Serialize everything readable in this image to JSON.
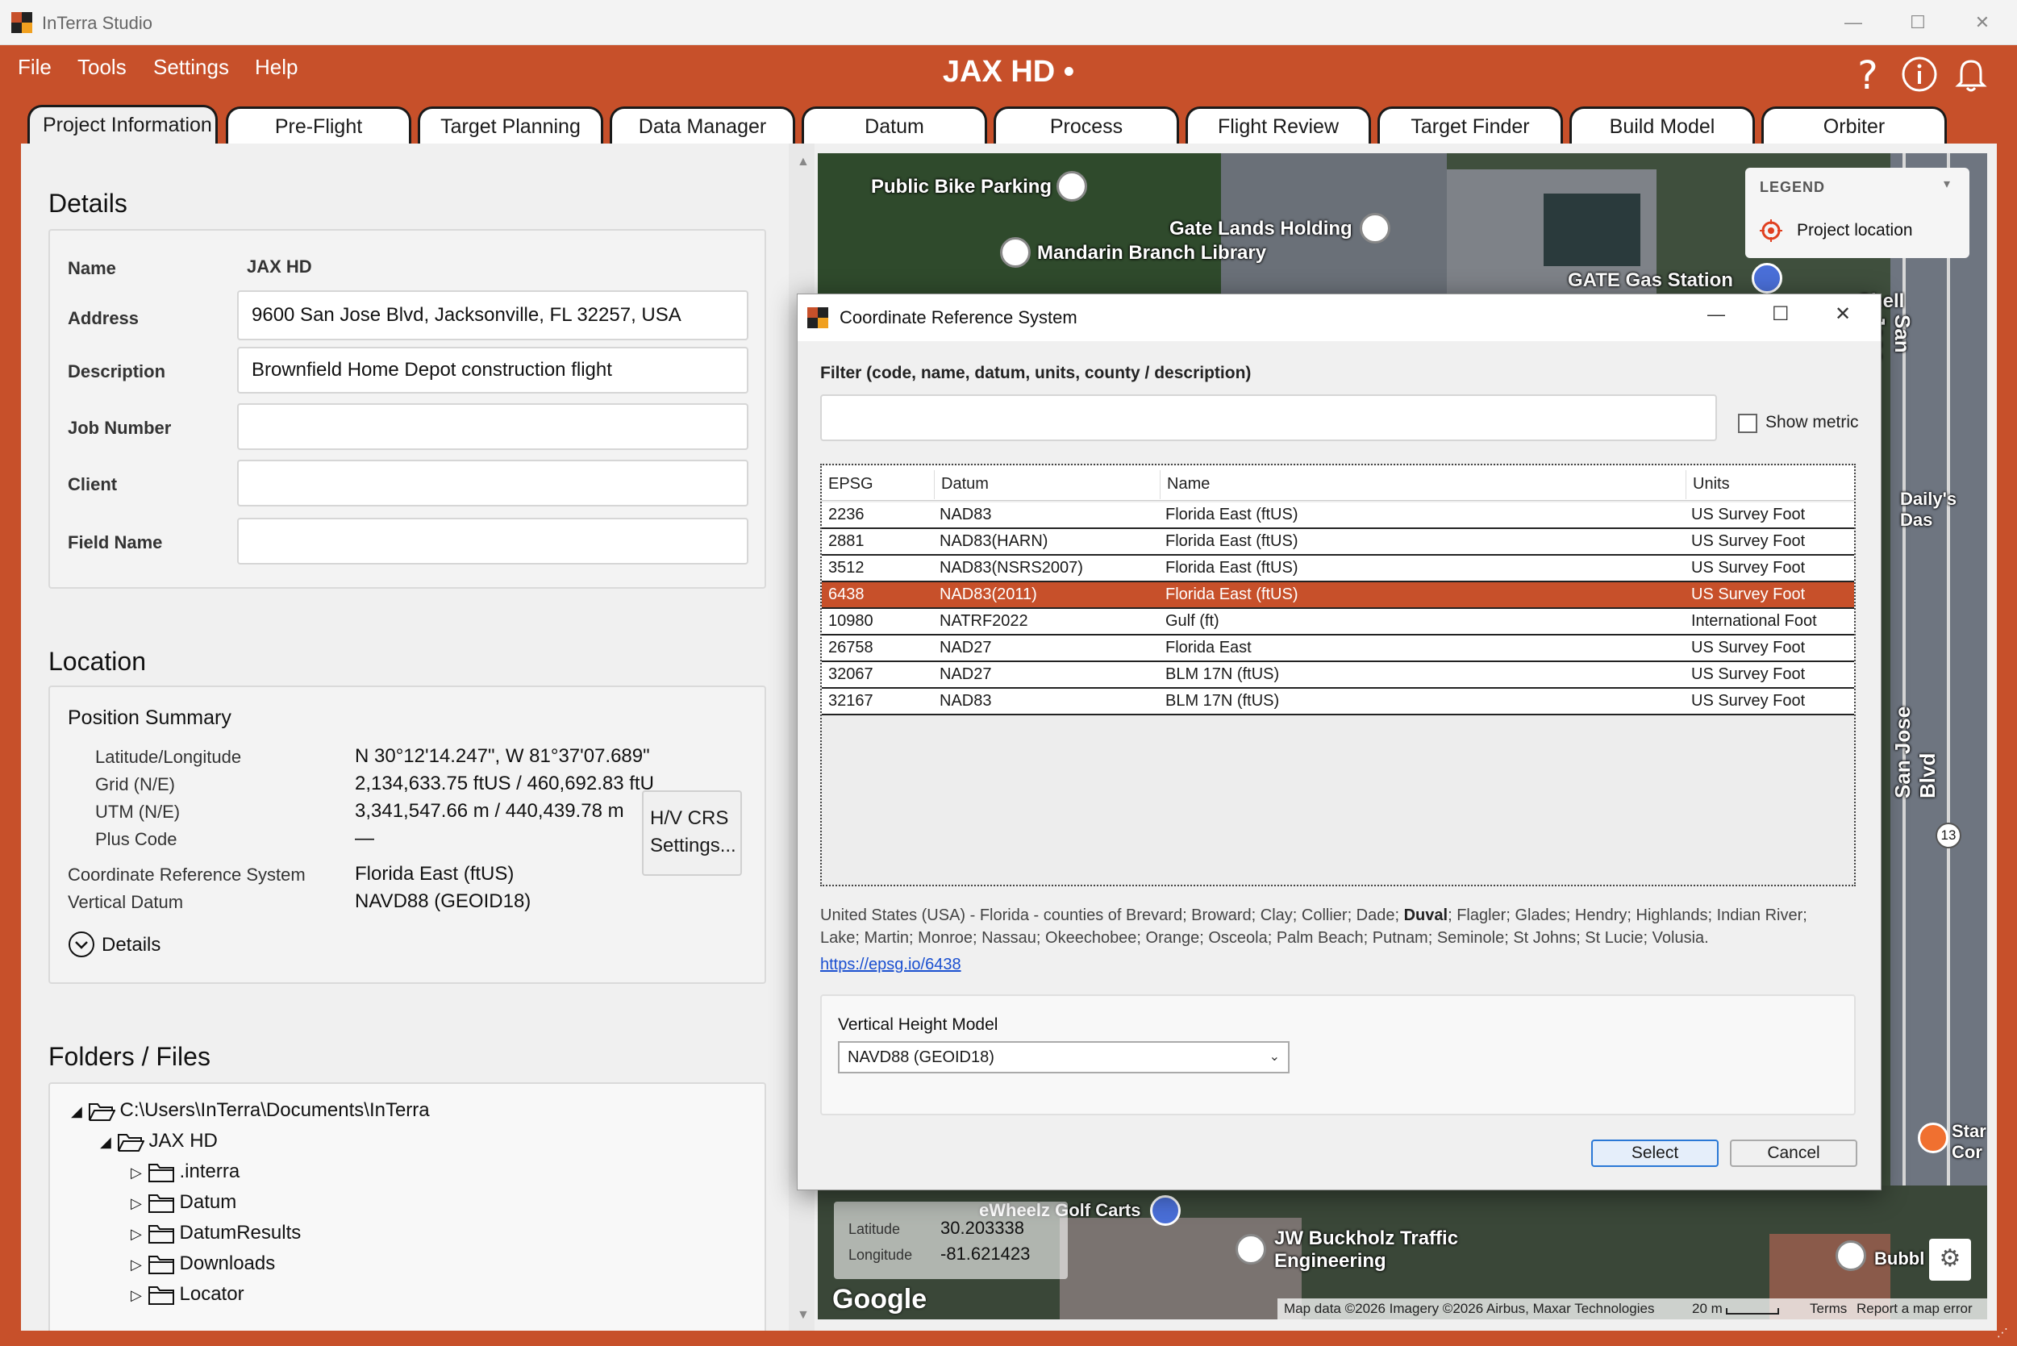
{
  "window": {
    "app_title": "InTerra Studio",
    "minimize": "—",
    "maximize": "☐",
    "close": "✕"
  },
  "menu": [
    "File",
    "Tools",
    "Settings",
    "Help"
  ],
  "project_title": "JAX HD •",
  "tabs": [
    "Project Information",
    "Pre-Flight",
    "Target Planning",
    "Data Manager",
    "Datum",
    "Process",
    "Flight Review",
    "Target Finder",
    "Build Model",
    "Orbiter"
  ],
  "details": {
    "title": "Details",
    "name_label": "Name",
    "name_value": "JAX HD",
    "address_label": "Address",
    "address_value": "9600 San Jose Blvd, Jacksonville, FL 32257, USA",
    "description_label": "Description",
    "description_value": "Brownfield Home Depot construction flight",
    "job_label": "Job Number",
    "client_label": "Client",
    "field_label": "Field Name"
  },
  "location": {
    "title": "Location",
    "summary_title": "Position Summary",
    "latlon_label": "Latitude/Longitude",
    "latlon_value": "N 30°12'14.247\", W 81°37'07.689\"",
    "grid_label": "Grid (N/E)",
    "grid_value": "2,134,633.75 ftUS / 460,692.83 ftU",
    "utm_label": "UTM (N/E)",
    "utm_value": "3,341,547.66 m / 440,439.78 m",
    "plus_label": "Plus Code",
    "plus_value": "—",
    "crs_label": "Coordinate Reference System",
    "crs_value": "Florida East (ftUS)",
    "vd_label": "Vertical Datum",
    "vd_value": "NAVD88 (GEOID18)",
    "hv_button_line1": "H/V CRS",
    "hv_button_line2": "Settings...",
    "details_toggle": "Details"
  },
  "folders": {
    "title": "Folders / Files",
    "root": "C:\\Users\\InTerra\\Documents\\InTerra",
    "project": "JAX HD",
    "children": [
      ".interra",
      "Datum",
      "DatumResults",
      "Downloads",
      "Locator"
    ]
  },
  "map": {
    "pois": [
      "Public Bike Parking",
      "Gate Lands Holding",
      "Mandarin Branch Library",
      "GATE Gas Station",
      "Shell",
      "San Jose Blvd",
      "Daily's Das",
      "San Jose Blvd",
      "Star Cor",
      "eWheelz Golf Carts",
      "JW Buckholz Traffic Engineering",
      "Bubbl"
    ],
    "route_badge": "13",
    "legend_title": "LEGEND",
    "legend_item": "Project location",
    "lat_label": "Latitude",
    "lat_value": "30.203338",
    "lon_label": "Longitude",
    "lon_value": "-81.621423",
    "google": "Google",
    "attribution": "Map data ©2026 Imagery ©2026 Airbus, Maxar Technologies",
    "scale": "20 m",
    "terms": "Terms",
    "report": "Report a map error"
  },
  "dialog": {
    "title": "Coordinate Reference System",
    "filter_label": "Filter (code, name, datum, units, county / description)",
    "filter_value": "",
    "show_metric": "Show metric",
    "columns": [
      "EPSG",
      "Datum",
      "Name",
      "Units"
    ],
    "rows": [
      [
        "2236",
        "NAD83",
        "Florida East (ftUS)",
        "US Survey Foot"
      ],
      [
        "2881",
        "NAD83(HARN)",
        "Florida East (ftUS)",
        "US Survey Foot"
      ],
      [
        "3512",
        "NAD83(NSRS2007)",
        "Florida East (ftUS)",
        "US Survey Foot"
      ],
      [
        "6438",
        "NAD83(2011)",
        "Florida East (ftUS)",
        "US Survey Foot"
      ],
      [
        "10980",
        "NATRF2022",
        "Gulf (ft)",
        "International Foot"
      ],
      [
        "26758",
        "NAD27",
        "Florida East",
        "US Survey Foot"
      ],
      [
        "32067",
        "NAD27",
        "BLM 17N (ftUS)",
        "US Survey Foot"
      ],
      [
        "32167",
        "NAD83",
        "BLM 17N (ftUS)",
        "US Survey Foot"
      ]
    ],
    "selected_row": 3,
    "desc_part1": "United States (USA) - Florida - counties of Brevard; Broward; Clay; Collier; Dade; ",
    "desc_bold": "Duval",
    "desc_part2": "; Flagler; Glades; Hendry; Highlands; Indian River;",
    "desc_line2": "Lake; Martin; Monroe; Nassau; Okeechobee; Orange; Osceola; Palm Beach; Putnam; Seminole; St Johns; St Lucie; Volusia.",
    "link": "https://epsg.io/6438",
    "vhm_label": "Vertical Height Model",
    "vhm_value": "NAVD88 (GEOID18)",
    "select_btn": "Select",
    "cancel_btn": "Cancel"
  },
  "colors": {
    "accent": "#c7502a",
    "selected_row": "#c7502a"
  }
}
